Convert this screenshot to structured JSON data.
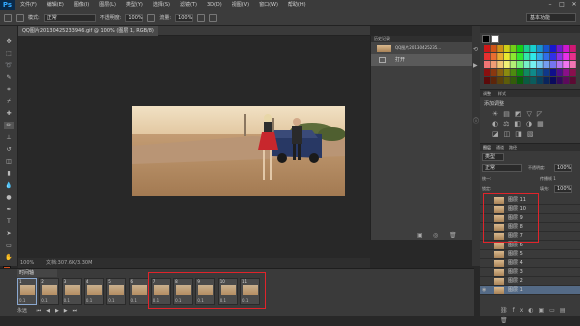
{
  "app": {
    "logo": "Ps"
  },
  "menu": [
    "文件(F)",
    "编辑(E)",
    "图像(I)",
    "图层(L)",
    "类型(Y)",
    "选择(S)",
    "滤镜(T)",
    "3D(D)",
    "视图(V)",
    "窗口(W)",
    "帮助(H)"
  ],
  "window_controls": [
    "–",
    "□",
    "✕"
  ],
  "options": {
    "mode_label": "模式:",
    "mode_value": "正常",
    "opacity_label": "不透明度:",
    "opacity_value": "100%",
    "flow_label": "流量:",
    "flow_value": "100%",
    "workspace": "基本功能"
  },
  "document": {
    "tab_title": "QQ图片20130425233946.gif @ 100% (图层 1, RGB/8)"
  },
  "status": {
    "zoom": "100%",
    "doc_size": "文档:307.6K/3.30M"
  },
  "history": {
    "tabs": [
      "历史记录"
    ],
    "snapshot": "QQ图片20130425235...",
    "items": [
      "打开"
    ]
  },
  "adjust_panel": {
    "tabs": [
      "调整",
      "样式"
    ],
    "title": "添加调整"
  },
  "layers_panel": {
    "tabs": [
      "图层",
      "通道",
      "路径"
    ],
    "kind": "类型",
    "blend": "正常",
    "opacity_label": "不透明度:",
    "opacity_value": "100%",
    "unify_label": "统一:",
    "propagate_label": "传播帧 1",
    "lock_label": "锁定:",
    "fill_label": "填充:",
    "fill_value": "100%",
    "layers": [
      "图层 11",
      "图层 10",
      "图层 9",
      "图层 8",
      "图层 7",
      "图层 6",
      "图层 5",
      "图层 4",
      "图层 3",
      "图层 2",
      "图层 1"
    ]
  },
  "timeline": {
    "title": "时间轴",
    "loop": "永远",
    "frames": [
      {
        "num": "1",
        "delay": "0.1"
      },
      {
        "num": "2",
        "delay": "0.1"
      },
      {
        "num": "3",
        "delay": "0.1"
      },
      {
        "num": "4",
        "delay": "0.1"
      },
      {
        "num": "5",
        "delay": "0.1"
      },
      {
        "num": "6",
        "delay": "0.1"
      },
      {
        "num": "7",
        "delay": "0.1"
      },
      {
        "num": "8",
        "delay": "0.1"
      },
      {
        "num": "9",
        "delay": "0.1"
      },
      {
        "num": "10",
        "delay": "0.1"
      },
      {
        "num": "11",
        "delay": "0.1"
      }
    ]
  },
  "colors": {
    "highlight": "#e0242b",
    "foreground": "#d4501e",
    "background": "#ffffff"
  }
}
